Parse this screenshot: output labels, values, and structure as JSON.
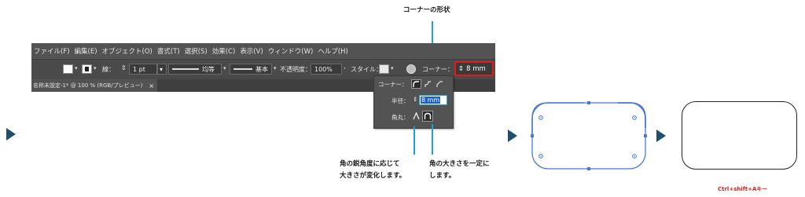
{
  "menu": [
    "ファイル(F)",
    "編集(E)",
    "オブジェクト(O)",
    "書式(T)",
    "選択(S)",
    "効果(C)",
    "表示(V)",
    "ウィンドウ(W)",
    "ヘルプ(H)"
  ],
  "control": {
    "stroke_label": "線：",
    "stroke_weight": "1 pt",
    "profile_uniform": "均等",
    "brush_basic": "基本",
    "opacity_label": "不透明度：",
    "opacity_value": "100%",
    "style_label": "スタイル：",
    "corner_label": "コーナー：",
    "corner_value": "8 mm"
  },
  "doc_tab": {
    "title": "名称未設定-1* @ 100 % (RGB/プレビュー)",
    "close": "×"
  },
  "panel": {
    "corner_label": "コーナー：",
    "radius_label": "半径：",
    "radius_value": "8 mm",
    "rounding_label": "角丸："
  },
  "callouts": {
    "corner_shape": "コーナーの形状",
    "relative": [
      "角の鋭角度に応じて",
      "大きさが変化します。"
    ],
    "absolute": [
      "角の大きさを一定に",
      "します。"
    ],
    "shortcut": "Ctrl+shift+Aキー"
  },
  "colors": {
    "accent_blue": "#1aa0dd",
    "highlight_red": "#e01a1a",
    "arrow": "#1f4f6d",
    "selection": "#4a78d6",
    "shortcut_text": "#e0201a"
  },
  "icons": [
    "right-triangle-icon",
    "rounded-corner-icon",
    "inverted-corner-icon",
    "chamfer-corner-icon",
    "spin-arrows-icon",
    "relative-rounding-icon",
    "absolute-rounding-icon",
    "globe-icon"
  ]
}
